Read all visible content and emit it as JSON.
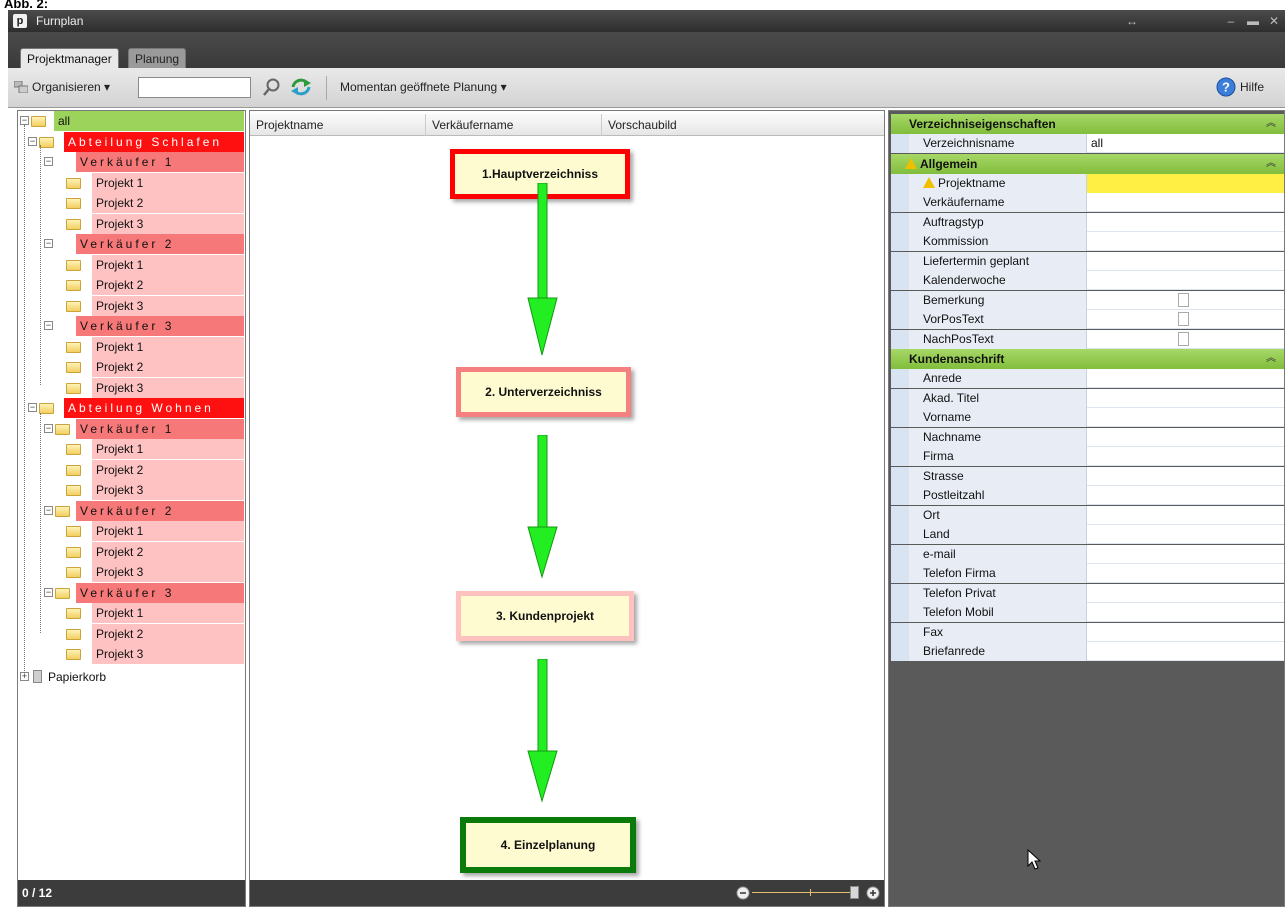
{
  "caption": "Abb. 2:",
  "window": {
    "title": "Furnplan",
    "icon_letter": "p"
  },
  "tabs": [
    {
      "label": "Projektmanager"
    },
    {
      "label": "Planung"
    }
  ],
  "toolbar": {
    "organize_label": "Organisieren",
    "search_value": "",
    "open_plans_label": "Momentan geöffnete Planung",
    "help_label": "Hilfe"
  },
  "tree": {
    "root": "all",
    "departments": [
      {
        "label": "Abteilung Schlafen",
        "sellers": [
          {
            "label": "Verkäufer 1",
            "projects": [
              "Projekt 1",
              "Projekt 2",
              "Projekt 3"
            ]
          },
          {
            "label": "Verkäufer 2",
            "projects": [
              "Projekt 1",
              "Projekt 2",
              "Projekt 3"
            ]
          },
          {
            "label": "Verkäufer 3",
            "projects": [
              "Projekt 1",
              "Projekt 2",
              "Projekt 3"
            ]
          }
        ]
      },
      {
        "label": "Abteilung Wohnen",
        "sellers": [
          {
            "label": "Verkäufer 1",
            "projects": [
              "Projekt 1",
              "Projekt 2",
              "Projekt 3"
            ]
          },
          {
            "label": "Verkäufer 2",
            "projects": [
              "Projekt 1",
              "Projekt 2",
              "Projekt 3"
            ]
          },
          {
            "label": "Verkäufer 3",
            "projects": [
              "Projekt 1",
              "Projekt 2",
              "Projekt 3"
            ]
          }
        ]
      }
    ],
    "trash": "Papierkorb",
    "status": "0 / 12"
  },
  "table": {
    "columns": [
      "Projektname",
      "Verkäufername",
      "Vorschaubild"
    ]
  },
  "flow": {
    "steps": [
      {
        "label": "1.Hauptverzeichniss",
        "border": "#ff0000"
      },
      {
        "label": "2. Unterverzeichniss",
        "border": "#f48080"
      },
      {
        "label": "3. Kundenprojekt",
        "border": "#ffc0c0"
      },
      {
        "label": "4. Einzelplanung",
        "border": "#0a7a0a"
      }
    ],
    "arrow_color": "#22ee22"
  },
  "properties": {
    "sections": [
      {
        "title": "Verzeichniseigenschaften",
        "warning": false,
        "rows": [
          {
            "name": "Verzeichnisname",
            "value": "all"
          }
        ]
      },
      {
        "title": "Allgemein",
        "warning": true,
        "rows": [
          {
            "name": "Projektname",
            "value": "",
            "warning": true,
            "highlight": "#ffee44"
          },
          {
            "name": "Verkäufername",
            "value": ""
          },
          {
            "name": "Auftragstyp",
            "value": ""
          },
          {
            "name": "Kommission",
            "value": ""
          },
          {
            "name": "Liefertermin geplant",
            "value": ""
          },
          {
            "name": "Kalenderwoche",
            "value": ""
          },
          {
            "name": "Bemerkung",
            "value": "",
            "doc": true
          },
          {
            "name": "VorPosText",
            "value": "",
            "doc": true
          },
          {
            "name": "NachPosText",
            "value": "",
            "doc": true
          }
        ]
      },
      {
        "title": "Kundenanschrift",
        "warning": false,
        "rows": [
          {
            "name": "Anrede",
            "value": ""
          },
          {
            "name": "Akad. Titel",
            "value": ""
          },
          {
            "name": "Vorname",
            "value": ""
          },
          {
            "name": "Nachname",
            "value": ""
          },
          {
            "name": "Firma",
            "value": ""
          },
          {
            "name": "Strasse",
            "value": ""
          },
          {
            "name": "Postleitzahl",
            "value": ""
          },
          {
            "name": "Ort",
            "value": ""
          },
          {
            "name": "Land",
            "value": ""
          },
          {
            "name": "e-mail",
            "value": ""
          },
          {
            "name": "Telefon Firma",
            "value": ""
          },
          {
            "name": "Telefon Privat",
            "value": ""
          },
          {
            "name": "Telefon Mobil",
            "value": ""
          },
          {
            "name": "Fax",
            "value": ""
          },
          {
            "name": "Briefanrede",
            "value": ""
          }
        ]
      }
    ]
  },
  "colors": {
    "accent_green": "#8cc63f",
    "dept_red": "#ff1010",
    "seller_salmon": "#f77878",
    "project_pink": "#ffc2c2"
  }
}
